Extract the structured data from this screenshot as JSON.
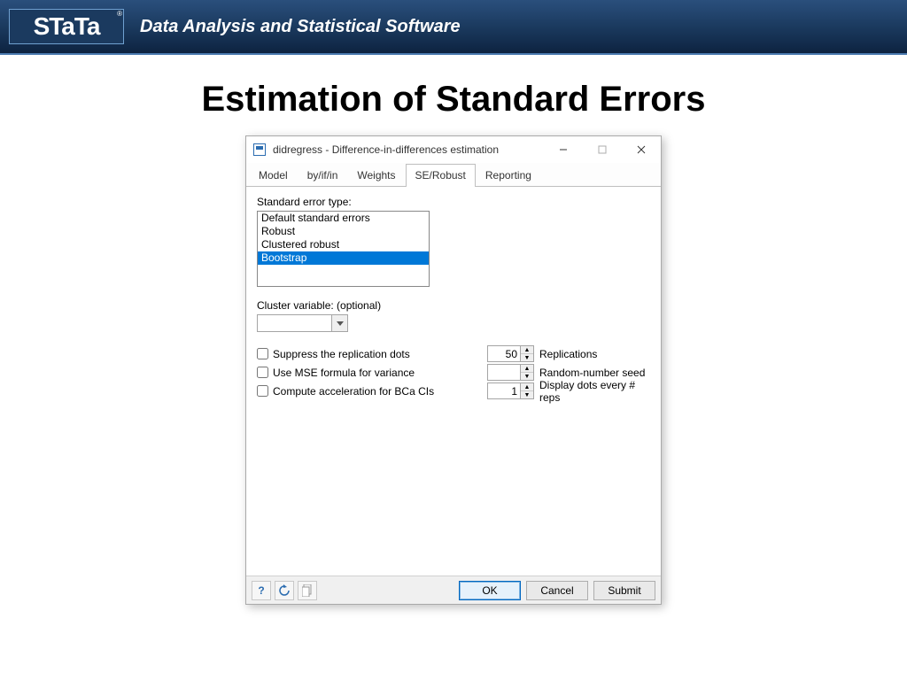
{
  "banner": {
    "logo_text": "STaTa",
    "tagline": "Data Analysis and Statistical Software"
  },
  "slide_title": "Estimation of Standard Errors",
  "dialog": {
    "title": "didregress - Difference-in-differences estimation",
    "tabs": [
      "Model",
      "by/if/in",
      "Weights",
      "SE/Robust",
      "Reporting"
    ],
    "active_tab": "SE/Robust",
    "se_type_label": "Standard error type:",
    "se_options": [
      "Default standard errors",
      "Robust",
      "Clustered robust",
      "Bootstrap"
    ],
    "se_selected": "Bootstrap",
    "cluster_label": "Cluster variable: (optional)",
    "cluster_value": "",
    "chk_suppress": "Suppress the replication dots",
    "chk_mse": "Use MSE formula for variance",
    "chk_bca": "Compute acceleration for BCa CIs",
    "reps_label": "Replications",
    "reps_value": "50",
    "seed_label": "Random-number seed",
    "seed_value": "",
    "dots_label": "Display dots every # reps",
    "dots_value": "1",
    "buttons": {
      "ok": "OK",
      "cancel": "Cancel",
      "submit": "Submit"
    }
  }
}
